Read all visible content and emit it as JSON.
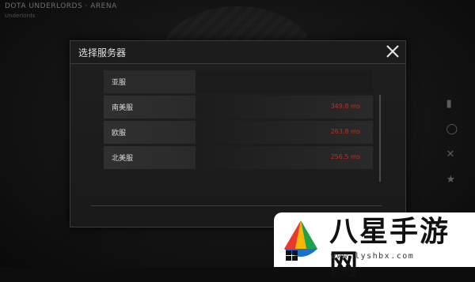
{
  "background": {
    "top_text": "DOTA UNDERLORDS · ARENA",
    "sub_text": "Underlords"
  },
  "dialog": {
    "title": "选择服务器",
    "close_icon": "close-icon",
    "servers": [
      {
        "name": "亚服",
        "ping": ""
      },
      {
        "name": "南美服",
        "ping": "349.8 ms"
      },
      {
        "name": "欧服",
        "ping": "263.8 ms"
      },
      {
        "name": "北美服",
        "ping": "256.5 ms"
      }
    ]
  },
  "colors": {
    "ping_red": "#c92a22",
    "dialog_bg": "#1d1d1e"
  },
  "watermark": {
    "name": "八星手游网",
    "url": "www.lyshbx.com"
  }
}
